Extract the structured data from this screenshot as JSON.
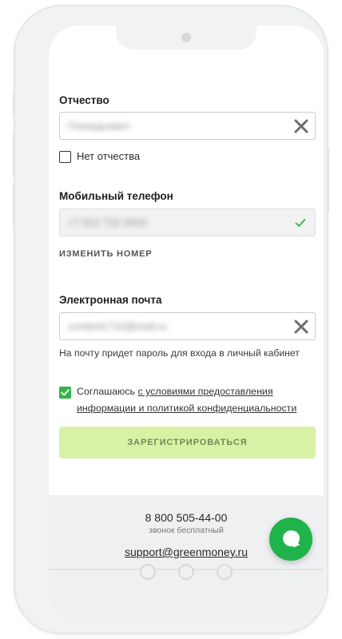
{
  "form": {
    "patronymic": {
      "label": "Отчество",
      "value": "Геннадьевич"
    },
    "no_patronymic": {
      "label": "Нет отчества",
      "checked": false
    },
    "mobile": {
      "label": "Мобильный телефон",
      "value": "+7 912 732 2003",
      "change_link": "ИЗМЕНИТЬ НОМЕР"
    },
    "email": {
      "label": "Электронная почта",
      "value": "content1710@mail.ru",
      "hint": "На почту придет пароль для входа в личный кабинет"
    },
    "agreement": {
      "prefix": "Соглашаюсь ",
      "link_text": "с условиями предоставления информации и политикой конфиденциальности",
      "checked": true
    },
    "submit_label": "ЗАРЕГИСТРИРОВАТЬСЯ"
  },
  "footer": {
    "phone": "8 800 505-44-00",
    "phone_note": "звонок бесплатный",
    "email": "support@greenmoney.ru"
  },
  "colors": {
    "accent_green": "#35b34a",
    "submit_bg": "#d8f2a5",
    "chat_button": "#1fb34a"
  },
  "icons": {
    "clear": "close-icon",
    "valid": "checkmark-icon",
    "chat": "chat-bubble-icon"
  }
}
